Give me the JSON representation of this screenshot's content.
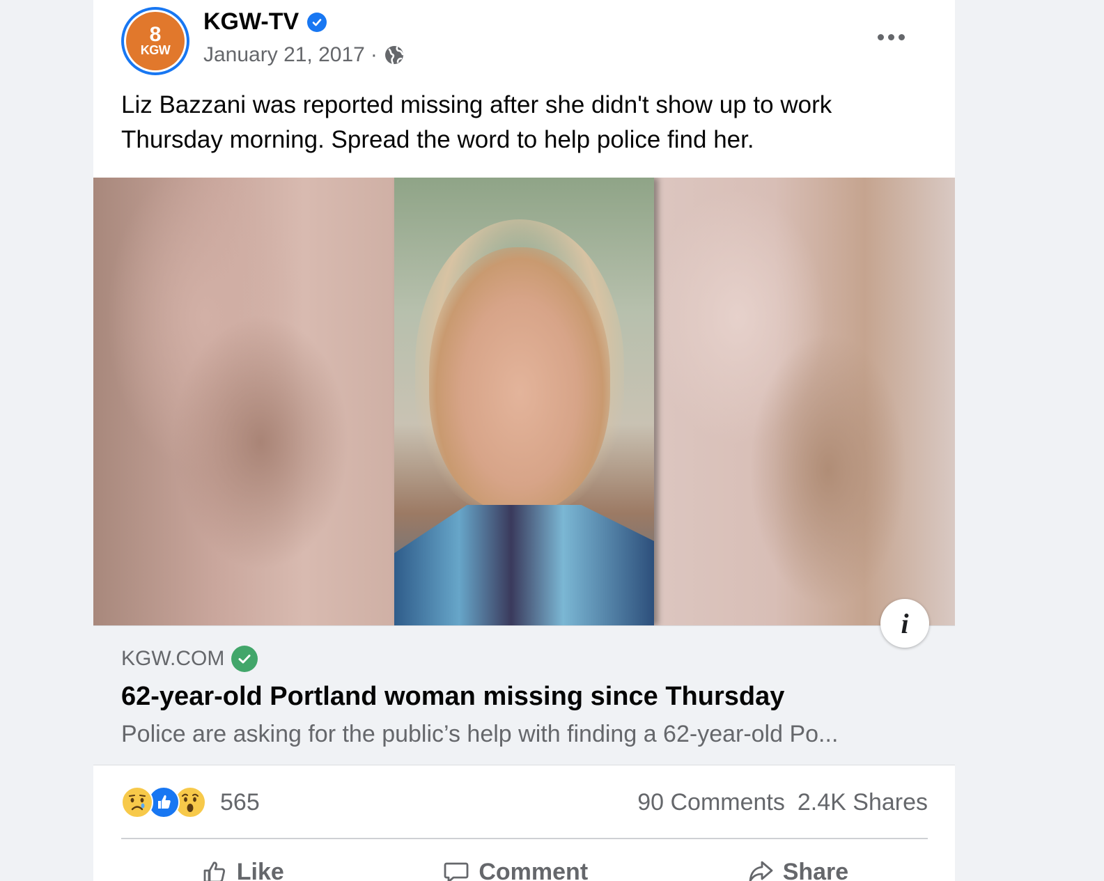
{
  "post": {
    "page_name": "KGW-TV",
    "avatar": {
      "top": "8",
      "bottom": "KGW"
    },
    "date": "January 21, 2017",
    "separator": "·",
    "text": "Liz Bazzani was reported missing after she didn't show up to work Thursday morning. Spread the word to help police find her.",
    "icons": {
      "verified": "verified-badge-icon",
      "audience": "globe-icon",
      "more": "more-options-icon",
      "info": "info-icon"
    },
    "info_label": "i"
  },
  "link": {
    "domain": "KGW.COM",
    "title": "62-year-old Portland woman missing since Thursday",
    "description": "Police are asking for the public’s help with finding a 62-year-old Po..."
  },
  "stats": {
    "reactions": [
      "sad",
      "like",
      "wow"
    ],
    "reaction_count": "565",
    "comments": "90 Comments",
    "shares": "2.4K Shares"
  },
  "actions": {
    "like": "Like",
    "comment": "Comment",
    "share": "Share"
  },
  "colors": {
    "accent": "#1877f2",
    "secondary_text": "#65676b",
    "avatar_bg": "#e1782c",
    "domain_check": "#42a66a"
  }
}
